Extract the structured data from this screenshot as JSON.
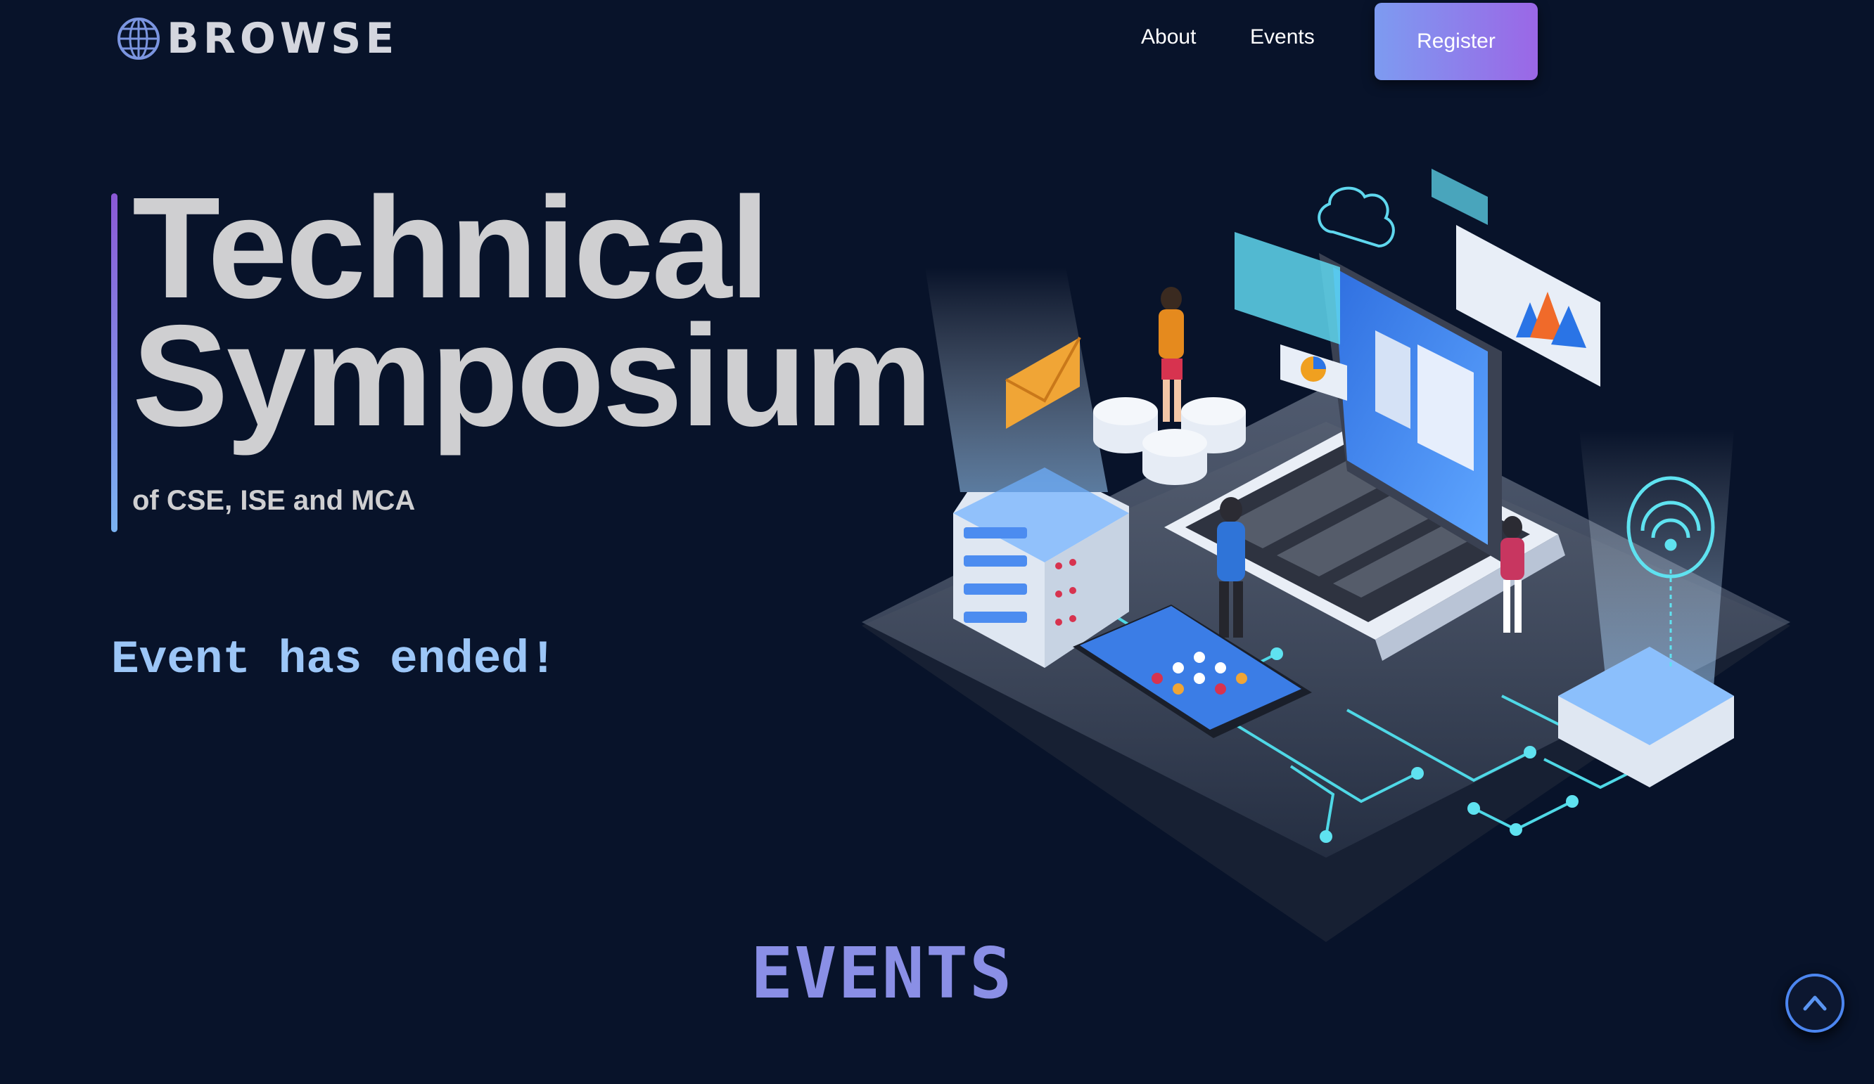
{
  "brand": {
    "name": "BROWSE",
    "logo_icon": "globe-icon"
  },
  "nav": {
    "links": [
      {
        "label": "About"
      },
      {
        "label": "Events"
      }
    ],
    "register_label": "Register"
  },
  "hero": {
    "title_line1": "Technical",
    "title_line2": "Symposium",
    "subtitle": "of CSE, ISE and MCA",
    "status": "Event has ended!",
    "illustration": "isometric-tech-illustration"
  },
  "events_section": {
    "heading": "EVENTS"
  },
  "scroll_top": {
    "icon": "chevron-up-icon"
  },
  "colors": {
    "background": "#08132a",
    "accent_gradient_start": "#7d9bf1",
    "accent_gradient_end": "#9b67e6",
    "heading_accent": "#8a8fe6",
    "status_text": "#9cc6f7"
  }
}
